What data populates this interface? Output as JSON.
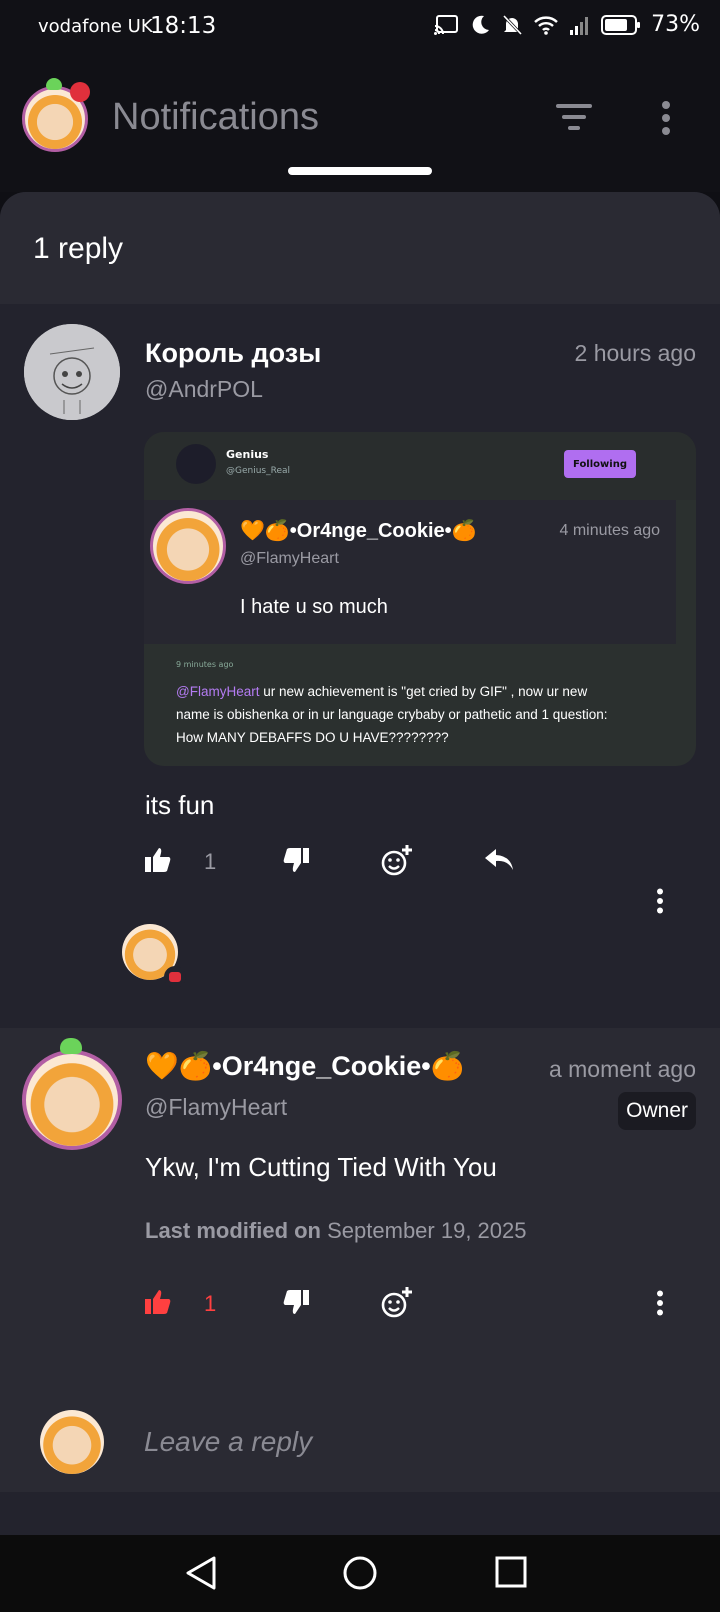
{
  "status_bar": {
    "carrier": "vodafone UK",
    "time": "18:13",
    "battery": "73%"
  },
  "header": {
    "title": "Notifications"
  },
  "sheet": {
    "title": "1 reply"
  },
  "comment_1": {
    "name": "Король дозы",
    "handle": "@AndrPOL",
    "time": "2 hours ago",
    "body": "its fun",
    "likes": "1",
    "embed": {
      "top_name": "Genius",
      "top_handle": "@Genius_Real",
      "follow_label": "Following",
      "inner_name": "🧡🍊•Or4nge_Cookie•🍊",
      "inner_handle": "@FlamyHeart",
      "inner_time": "4 minutes ago",
      "inner_text": "I hate u so much",
      "small_time": "9 minutes ago",
      "mention": "@FlamyHeart",
      "message": " ur new achievement is \"get cried by GIF\" , now ur new name is obishenka or in ur language crybaby or pathetic and 1 question: How MANY DEBAFFS DO U HAVE????????"
    }
  },
  "comment_2": {
    "name": "🧡🍊•Or4nge_Cookie•🍊",
    "handle": "@FlamyHeart",
    "time": "a moment ago",
    "badge": "Owner",
    "body": "Ykw, I'm Cutting Tied With You",
    "modified_label": "Last modified on",
    "modified_date": "September 19, 2025",
    "likes": "1"
  },
  "reply_bar": {
    "placeholder": "Leave a reply"
  },
  "colors": {
    "accent_purple": "#b06ef0",
    "liked_red": "#ff4040",
    "sheet_bg": "#23232d"
  },
  "icons": [
    "cast-icon",
    "moon-icon",
    "bell-off-icon",
    "wifi-icon",
    "signal-icon",
    "battery-icon",
    "filter-icon",
    "more-vertical-icon",
    "thumbs-up-icon",
    "thumbs-down-icon",
    "add-reaction-icon",
    "reply-icon",
    "back-icon",
    "home-icon",
    "recents-icon"
  ]
}
